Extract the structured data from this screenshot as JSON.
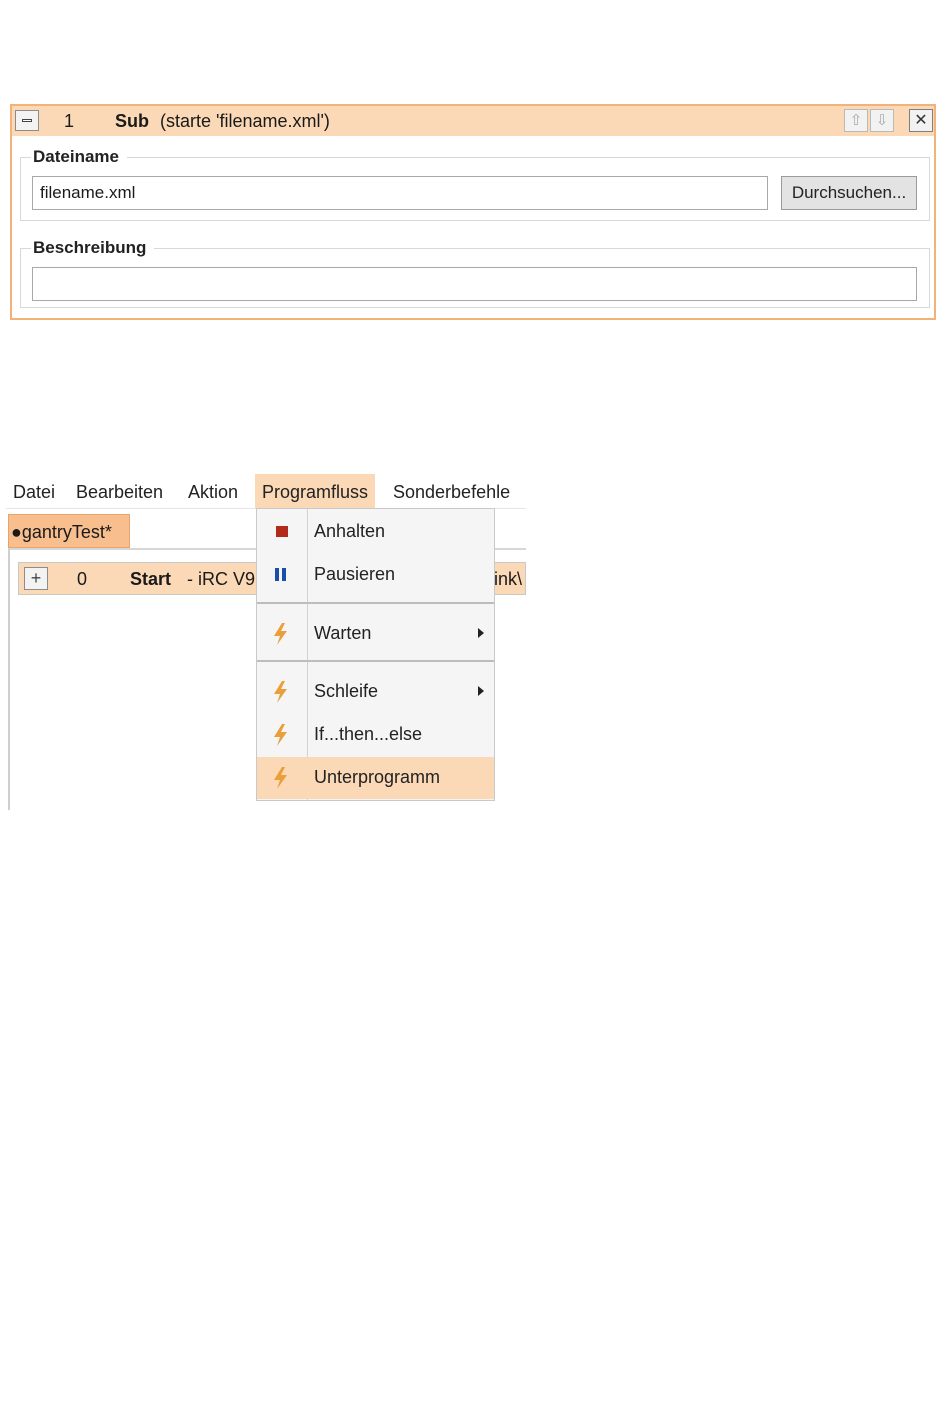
{
  "sub_block": {
    "number": "1",
    "type": "Sub",
    "description": "(starte 'filename.xml')",
    "filename_group_title": "Dateiname",
    "filename_value": "filename.xml",
    "browse_label": "Durchsuchen...",
    "description_group_title": "Beschreibung",
    "description_value": "",
    "move_up_icon": "arrow-up-icon",
    "move_down_icon": "arrow-down-icon",
    "close_icon": "close-icon"
  },
  "menubar": {
    "items": [
      "Datei",
      "Bearbeiten",
      "Aktion",
      "Programfluss",
      "Sonderbefehle"
    ],
    "active": "Programfluss"
  },
  "tab": {
    "label": "●gantryTest*"
  },
  "start_row": {
    "number": "0",
    "name": "Start",
    "description": "- iRC V9",
    "description_tail": "ink\\"
  },
  "dropdown": {
    "items": [
      {
        "label": "Anhalten",
        "icon": "stop-icon",
        "color": "#b22a1a",
        "submenu": false
      },
      {
        "label": "Pausieren",
        "icon": "pause-icon",
        "color": "#1a4fa8",
        "submenu": false
      },
      {
        "label": "Warten",
        "icon": "lightning-icon",
        "color": "#e9a03a",
        "submenu": true
      },
      {
        "label": "Schleife",
        "icon": "lightning-icon",
        "color": "#e9a03a",
        "submenu": true
      },
      {
        "label": "If...then...else",
        "icon": "lightning-icon",
        "color": "#e9a03a",
        "submenu": false
      },
      {
        "label": "Unterprogramm",
        "icon": "lightning-icon",
        "color": "#e9a03a",
        "submenu": false,
        "highlighted": true
      }
    ]
  },
  "colors": {
    "accent_orange": "#fbd8b6",
    "tab_orange": "#f8be8e",
    "panel_border": "#f3b27a"
  }
}
